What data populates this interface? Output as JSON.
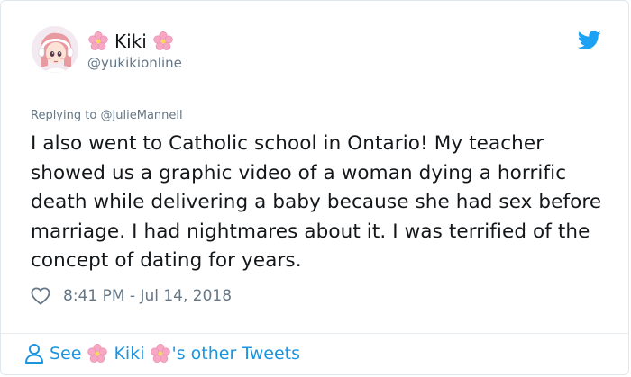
{
  "user": {
    "display_name": "Kiki",
    "handle": "@yukikionline",
    "avatar": "avatar-illustration"
  },
  "reply": {
    "prefix": "Replying to",
    "mention": "@JulieMannell"
  },
  "tweet": {
    "text": "I also went to Catholic school in Ontario! My teacher showed us a graphic video of a woman dying a horrific death while delivering a baby because she had sex before marriage.  I had nightmares about it. I was terrified of the concept of dating for years.",
    "timestamp": "8:41 PM - Jul 14, 2018"
  },
  "footer": {
    "see_label": "See",
    "name": "Kiki",
    "suffix": "'s other Tweets"
  },
  "icons": {
    "brand": "twitter-bird-icon",
    "like": "heart-icon",
    "person": "person-icon",
    "decoration": "cherry-blossom-icon"
  },
  "colors": {
    "accent": "#1b95e0",
    "text": "#14171a",
    "secondary": "#657786",
    "blossom": "#f4a6c1"
  }
}
